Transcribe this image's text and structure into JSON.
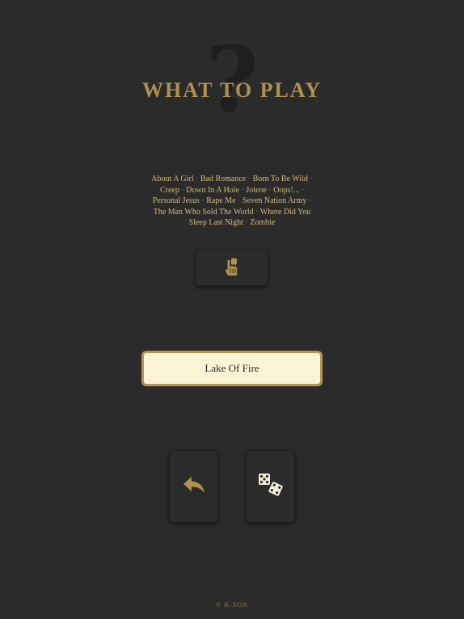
{
  "header": {
    "decoration": "?",
    "title": "WHAT TO PLAY"
  },
  "song_list": {
    "songs": [
      "About A Girl",
      "Bad Romance",
      "Born To Be Wild",
      "Creep",
      "Down In A Hole",
      "Jolene",
      "Oops!...",
      "Personal Jesus",
      "Rape Me",
      "Seven Nation Army",
      "The Man Who Sold The World",
      "Where Did You Sleep Last Night",
      "Zombie"
    ],
    "separator": " · "
  },
  "tap_button": {
    "icon": "hand-pointer-icon"
  },
  "result": {
    "song": "Lake Of Fire"
  },
  "controls": {
    "back_icon": "reply-arrow-icon",
    "random_icon": "dice-icon"
  },
  "footer": {
    "text": "© K-SON"
  },
  "colors": {
    "background": "#2b2b2b",
    "accent": "#b0914c",
    "list_text": "#d4b97a",
    "result_bg": "#fbf3d5",
    "result_border": "#b6964f"
  }
}
